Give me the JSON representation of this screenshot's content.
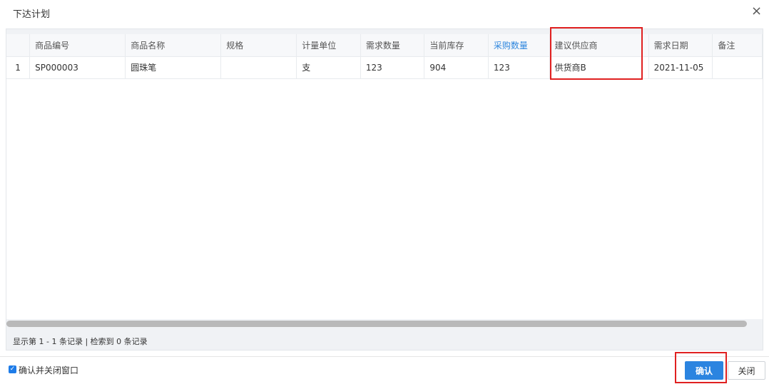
{
  "dialog": {
    "title": "下达计划",
    "close_icon": "×"
  },
  "table": {
    "columns": [
      "",
      "商品编号",
      "商品名称",
      "规格",
      "计量单位",
      "需求数量",
      "当前库存",
      "采购数量",
      "建议供应商",
      "需求日期",
      "备注"
    ],
    "rows": [
      [
        "1",
        "SP000003",
        "圆珠笔",
        "",
        "支",
        "123",
        "904",
        "123",
        "供货商B",
        "2021-11-05",
        ""
      ]
    ]
  },
  "footer": {
    "summary": "显示第 1 - 1 条记录 | 检索到 0 条记录"
  },
  "bottom": {
    "checkbox_label": "确认并关闭窗口",
    "checkbox_checked": true,
    "confirm_label": "确认",
    "close_label": "关闭"
  },
  "colors": {
    "accent": "#2b84e0",
    "highlight": "#e02020",
    "header_blue": "#2e86de"
  }
}
